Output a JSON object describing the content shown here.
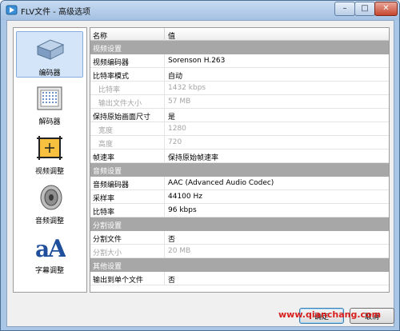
{
  "window": {
    "title": "FLV文件 - 高级选项"
  },
  "sidebar": {
    "items": [
      {
        "label": "编码器",
        "icon": "encoder-device-icon",
        "active": true
      },
      {
        "label": "解码器",
        "icon": "decoder-chip-icon",
        "active": false
      },
      {
        "label": "视频调整",
        "icon": "video-adjust-icon",
        "active": false
      },
      {
        "label": "音频调整",
        "icon": "speaker-icon",
        "active": false
      },
      {
        "label": "字幕调整",
        "icon": "subtitle-font-icon",
        "active": false
      }
    ]
  },
  "grid": {
    "header": {
      "name": "名称",
      "value": "值"
    },
    "rows": [
      {
        "type": "category",
        "name": "视频设置"
      },
      {
        "type": "prop",
        "name": "视频编码器",
        "value": "Sorenson H.263"
      },
      {
        "type": "prop",
        "name": "比特率模式",
        "value": "自动"
      },
      {
        "type": "prop",
        "name": "比特率",
        "value": "1432 kbps",
        "sub": true,
        "disabled": true
      },
      {
        "type": "prop",
        "name": "输出文件大小",
        "value": "57 MB",
        "sub": true,
        "disabled": true
      },
      {
        "type": "prop",
        "name": "保持原始画面尺寸",
        "value": "是"
      },
      {
        "type": "prop",
        "name": "宽度",
        "value": "1280",
        "sub": true,
        "disabled": true
      },
      {
        "type": "prop",
        "name": "高度",
        "value": "720",
        "sub": true,
        "disabled": true
      },
      {
        "type": "prop",
        "name": "帧速率",
        "value": "保持原始帧速率"
      },
      {
        "type": "category",
        "name": "音频设置"
      },
      {
        "type": "prop",
        "name": "音频编码器",
        "value": "AAC (Advanced Audio Codec)"
      },
      {
        "type": "prop",
        "name": "采样率",
        "value": "44100 Hz"
      },
      {
        "type": "prop",
        "name": "比特率",
        "value": "96 kbps"
      },
      {
        "type": "category",
        "name": "分割设置"
      },
      {
        "type": "prop",
        "name": "分割文件",
        "value": "否"
      },
      {
        "type": "prop",
        "name": "分割大小",
        "value": "20 MB",
        "disabled": true
      },
      {
        "type": "category",
        "name": "其他设置"
      },
      {
        "type": "prop",
        "name": "输出到单个文件",
        "value": "否"
      }
    ]
  },
  "buttons": {
    "ok": "确定",
    "cancel": "取消"
  },
  "watermark": "www.qianchang.com"
}
